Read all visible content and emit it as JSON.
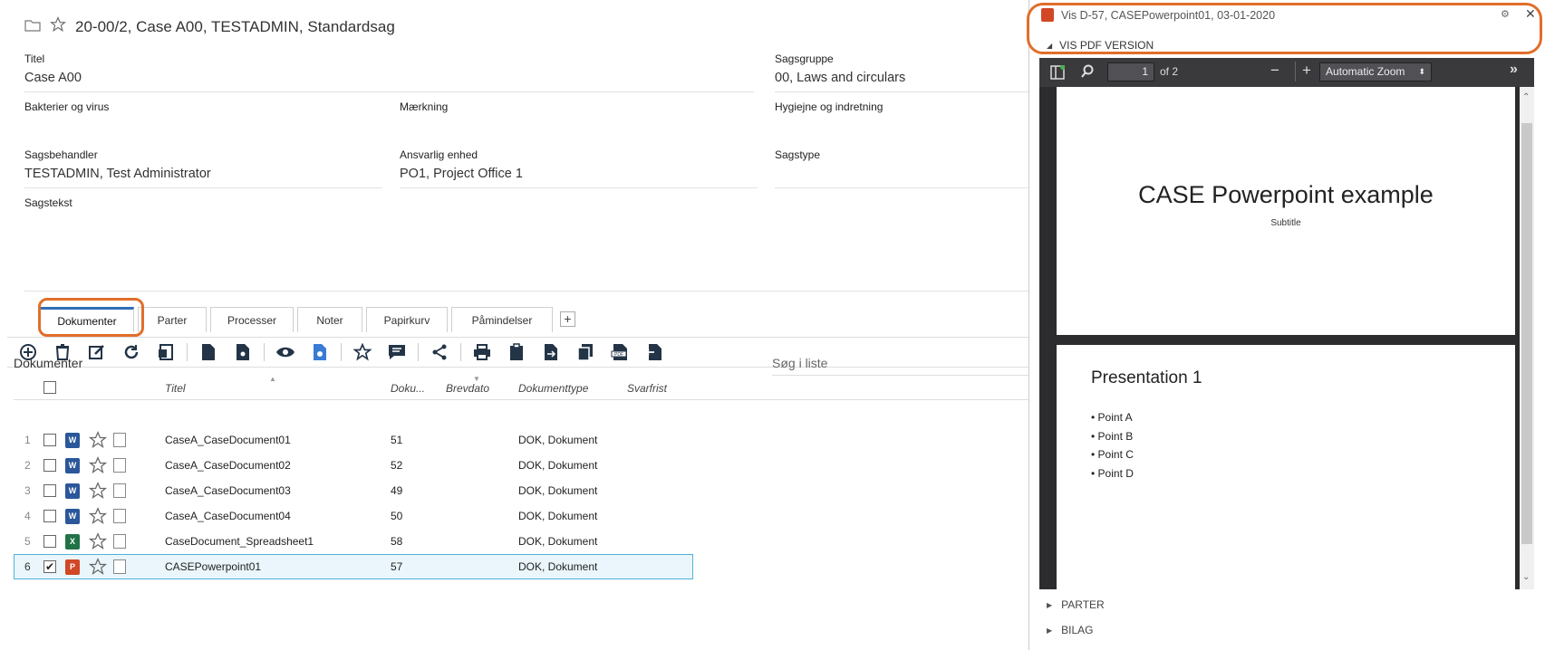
{
  "case": {
    "title": "20-00/2, Case A00, TESTADMIN, Standardsag"
  },
  "fields": {
    "titel": {
      "label": "Titel",
      "value": "Case A00"
    },
    "sagsgruppe": {
      "label": "Sagsgruppe",
      "value": "00, Laws and circulars"
    },
    "bakterier": {
      "label": "Bakterier og virus",
      "value": ""
    },
    "maerkning": {
      "label": "Mærkning",
      "value": ""
    },
    "hygiejne": {
      "label": "Hygiejne og indretning",
      "value": ""
    },
    "sagsbehandler": {
      "label": "Sagsbehandler",
      "value": "TESTADMIN, Test Administrator"
    },
    "ansvarlig": {
      "label": "Ansvarlig enhed",
      "value": "PO1, Project Office 1"
    },
    "sagstype": {
      "label": "Sagstype",
      "value": ""
    },
    "sagstekst": {
      "label": "Sagstekst",
      "value": ""
    }
  },
  "tabs": [
    "Dokumenter",
    "Parter",
    "Processer",
    "Noter",
    "Papirkurv",
    "Påmindelser"
  ],
  "tab_add": "+",
  "list": {
    "title": "Dokumenter",
    "search_placeholder": "Søg i liste",
    "columns": {
      "titel": "Titel",
      "doku": "Doku...",
      "brevdato": "Brevdato",
      "type": "Dokumenttype",
      "svarfrist": "Svarfrist"
    },
    "rows": [
      {
        "num": "1",
        "app": "W",
        "title": "CaseA_CaseDocument01",
        "doku": "51",
        "type": "DOK, Dokument",
        "checked": ""
      },
      {
        "num": "2",
        "app": "W",
        "title": "CaseA_CaseDocument02",
        "doku": "52",
        "type": "DOK, Dokument",
        "checked": ""
      },
      {
        "num": "3",
        "app": "W",
        "title": "CaseA_CaseDocument03",
        "doku": "49",
        "type": "DOK, Dokument",
        "checked": ""
      },
      {
        "num": "4",
        "app": "W",
        "title": "CaseA_CaseDocument04",
        "doku": "50",
        "type": "DOK, Dokument",
        "checked": ""
      },
      {
        "num": "5",
        "app": "X",
        "title": "CaseDocument_Spreadsheet1",
        "doku": "58",
        "type": "DOK, Dokument",
        "checked": ""
      },
      {
        "num": "6",
        "app": "P",
        "title": "CASEPowerpoint01",
        "doku": "57",
        "type": "DOK, Dokument",
        "checked": "✔"
      }
    ]
  },
  "colors": {
    "accent": "#2e6fb7",
    "highlight": "#e06e2a",
    "selected_row": "#eaf6fb",
    "word": "#2b579a",
    "excel": "#217346",
    "powerpoint": "#d24726"
  },
  "viewer": {
    "title": "Vis D-57, CASEPowerpoint01, 03-01-2020",
    "pdf_section": "VIS PDF VERSION",
    "page_input": "1",
    "page_total": "of 2",
    "zoom": "Automatic Zoom",
    "slide1_title": "CASE Powerpoint example",
    "slide1_subtitle": "Subtitle",
    "slide2_title": "Presentation 1",
    "bullets": [
      "Point A",
      "Point B",
      "Point C",
      "Point D"
    ],
    "sections": [
      "PARTER",
      "BILAG"
    ]
  }
}
